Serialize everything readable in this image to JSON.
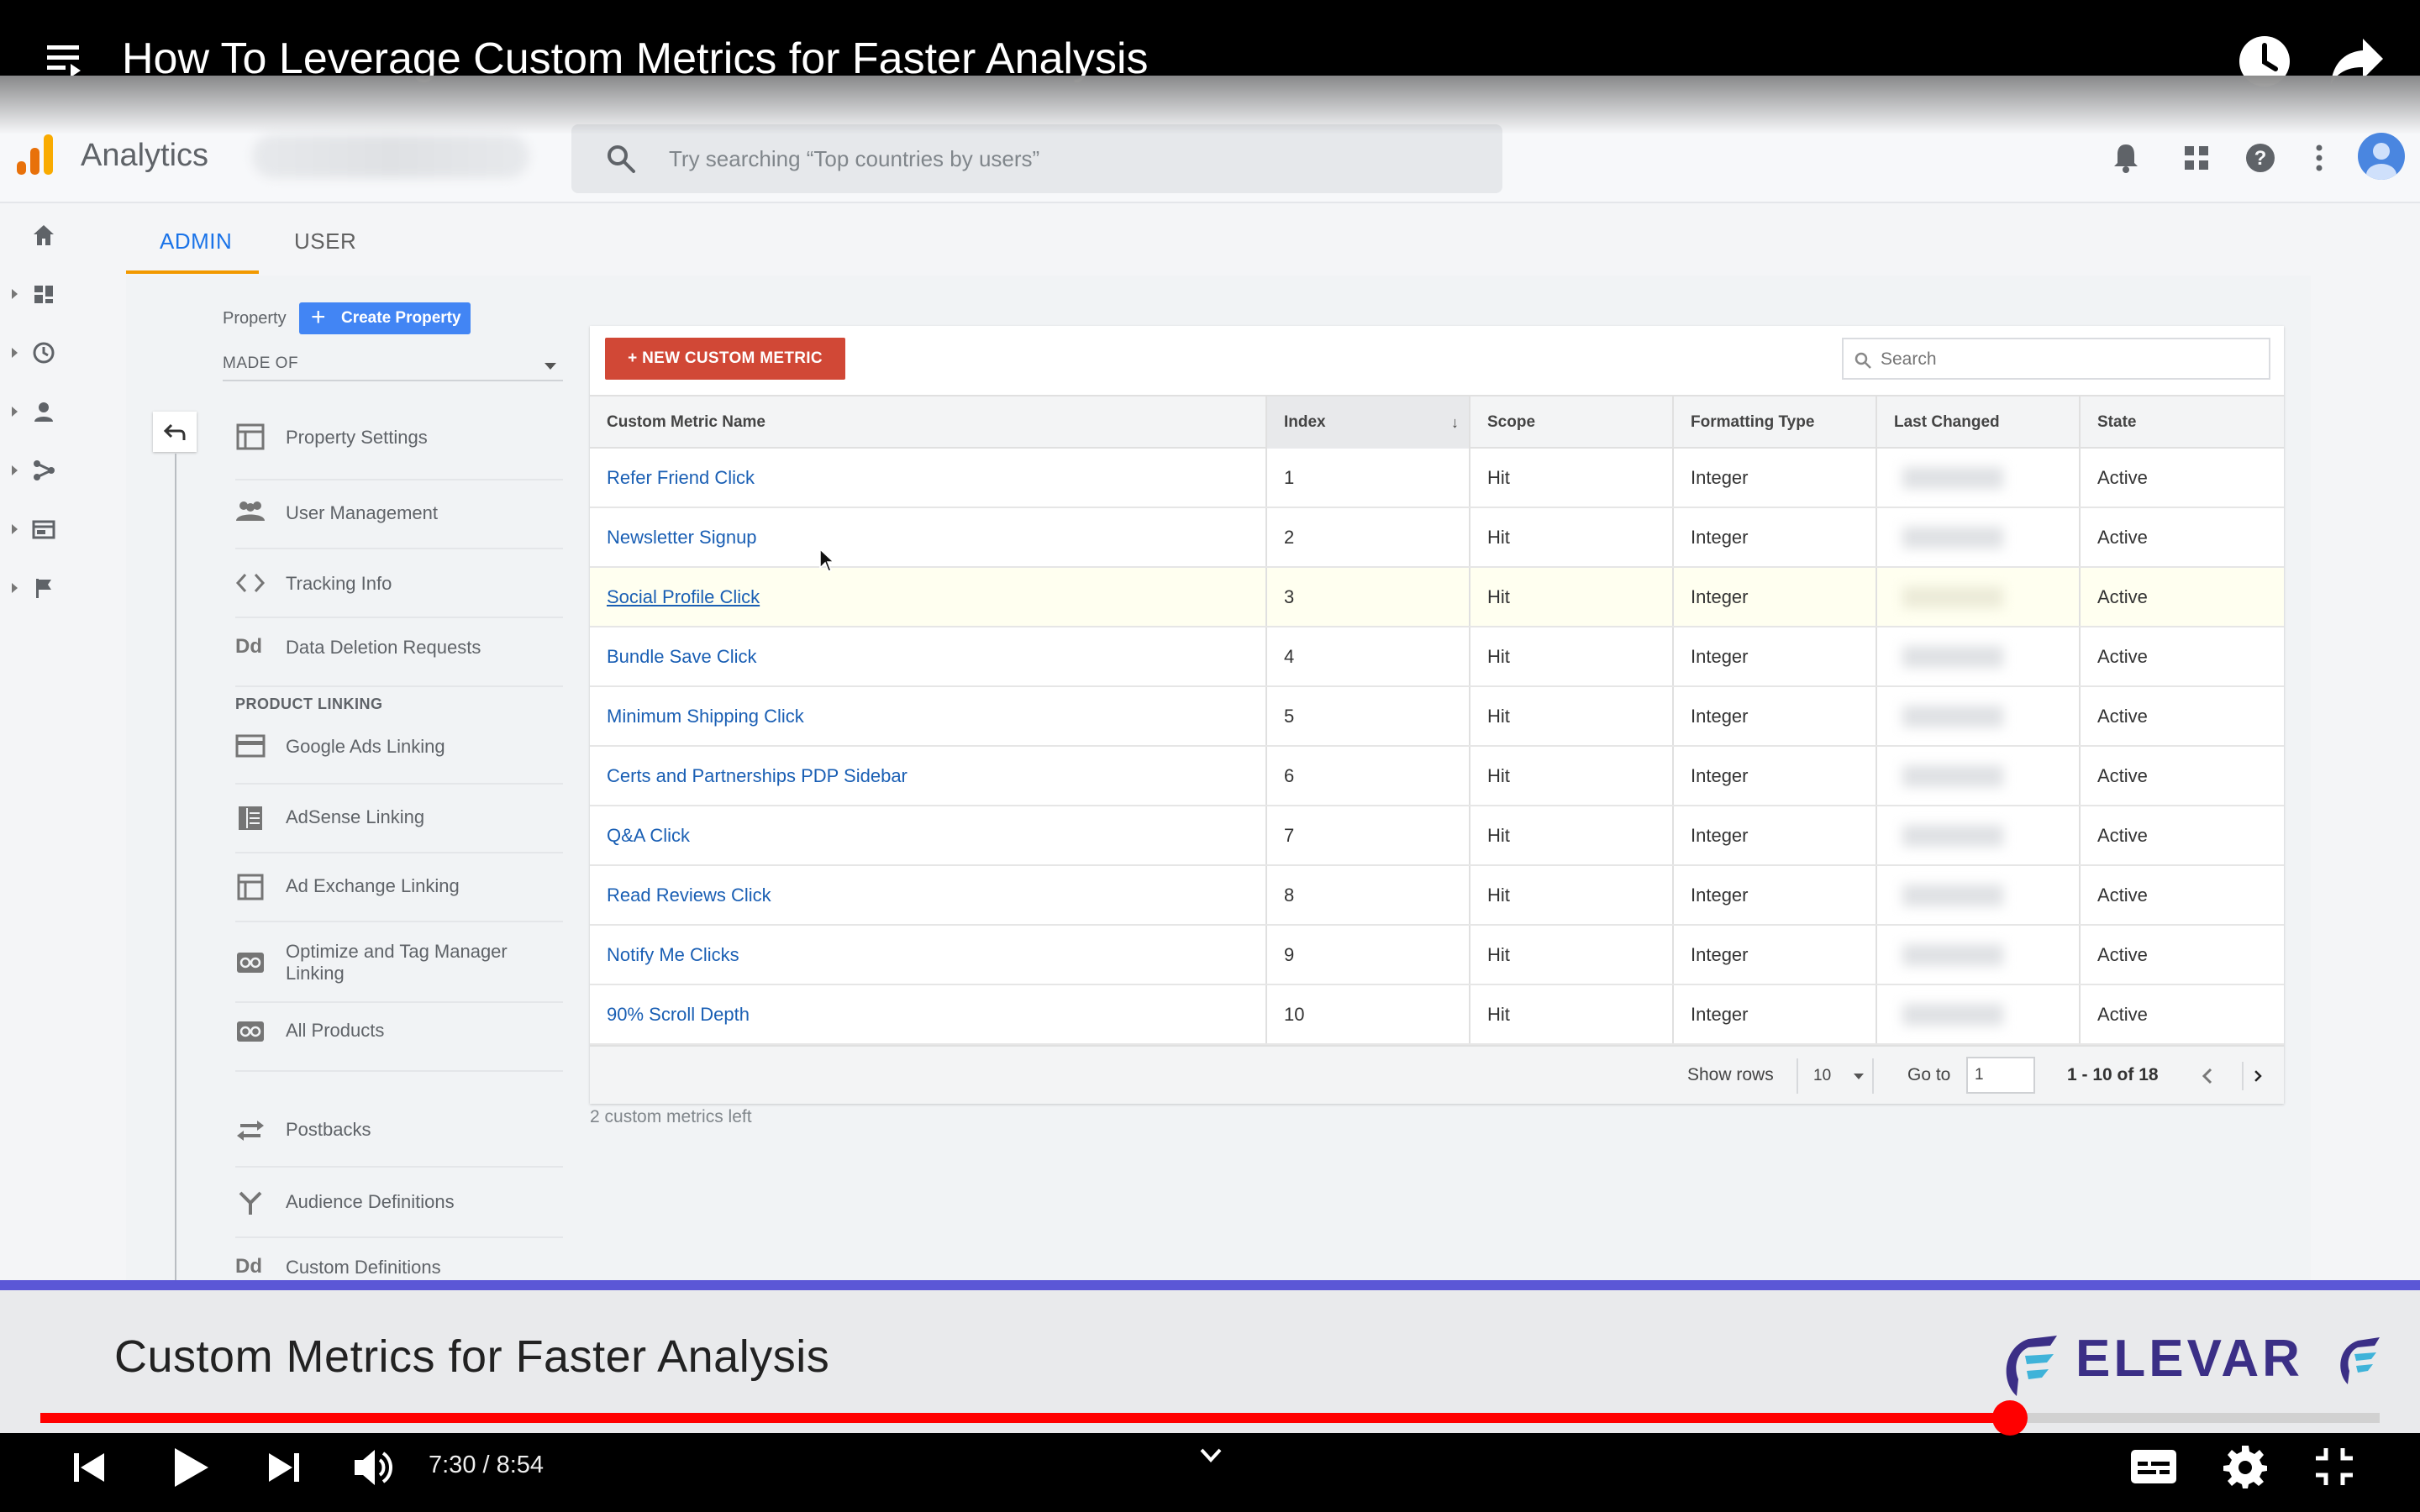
{
  "player": {
    "title": "How To Leverage Custom Metrics for Faster Analysis",
    "time": "7:30 / 8:54",
    "progress_fraction": 0.842
  },
  "ga": {
    "app_name": "Analytics",
    "search_placeholder": "Try searching “Top countries by users”",
    "tabs": [
      "ADMIN",
      "USER"
    ],
    "property_label": "Property",
    "create_property": "Create Property",
    "property_select": "MADE OF",
    "nav": {
      "property_settings": "Property Settings",
      "user_management": "User Management",
      "tracking_info": "Tracking Info",
      "data_deletion": "Data Deletion Requests",
      "section_product_linking": "PRODUCT LINKING",
      "google_ads": "Google Ads Linking",
      "adsense": "AdSense Linking",
      "ad_exchange": "Ad Exchange Linking",
      "optimize": "Optimize and Tag Manager Linking",
      "all_products": "All Products",
      "postbacks": "Postbacks",
      "audience_definitions": "Audience Definitions",
      "custom_definitions": "Custom Definitions",
      "dd_glyph": "Dd"
    },
    "table": {
      "new_button": "+ NEW CUSTOM METRIC",
      "search_placeholder": "Search",
      "columns": [
        "Custom Metric Name",
        "Index",
        "Scope",
        "Formatting Type",
        "Last Changed",
        "State"
      ],
      "sort_indicator": "↓",
      "rows": [
        {
          "name": "Refer Friend Click",
          "index": "1",
          "scope": "Hit",
          "format": "Integer",
          "state": "Active"
        },
        {
          "name": "Newsletter Signup",
          "index": "2",
          "scope": "Hit",
          "format": "Integer",
          "state": "Active"
        },
        {
          "name": "Social Profile Click",
          "index": "3",
          "scope": "Hit",
          "format": "Integer",
          "state": "Active"
        },
        {
          "name": "Bundle Save Click",
          "index": "4",
          "scope": "Hit",
          "format": "Integer",
          "state": "Active"
        },
        {
          "name": "Minimum Shipping Click",
          "index": "5",
          "scope": "Hit",
          "format": "Integer",
          "state": "Active"
        },
        {
          "name": "Certs and Partnerships PDP Sidebar",
          "index": "6",
          "scope": "Hit",
          "format": "Integer",
          "state": "Active"
        },
        {
          "name": "Q&A Click",
          "index": "7",
          "scope": "Hit",
          "format": "Integer",
          "state": "Active"
        },
        {
          "name": "Read Reviews Click",
          "index": "8",
          "scope": "Hit",
          "format": "Integer",
          "state": "Active"
        },
        {
          "name": "Notify Me Clicks",
          "index": "9",
          "scope": "Hit",
          "format": "Integer",
          "state": "Active"
        },
        {
          "name": "90% Scroll Depth",
          "index": "10",
          "scope": "Hit",
          "format": "Integer",
          "state": "Active"
        }
      ],
      "show_rows_label": "Show rows",
      "rows_per_page": "10",
      "goto_label": "Go to",
      "goto_value": "1",
      "page_range": "1 - 10 of 18",
      "metrics_left": "2 custom metrics left"
    }
  },
  "banner": {
    "title": "Custom Metrics for Faster Analysis",
    "brand": "ELEVAR"
  },
  "colors": {
    "accent_blue": "#1a73e8",
    "progress_red": "#ff0000",
    "new_button_red": "#d14836",
    "brand_purple": "#3b2f86"
  }
}
